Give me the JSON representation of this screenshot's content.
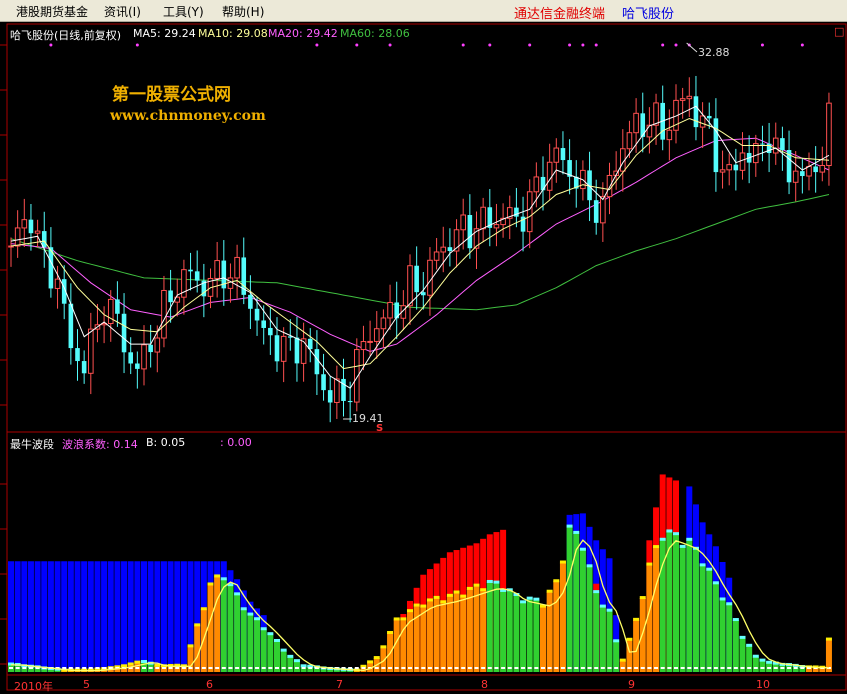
{
  "menu": {
    "items": [
      "港股期货基金",
      "资讯(I)",
      "工具(Y)",
      "帮助(H)"
    ],
    "brand_terminal": "通达信金融终端",
    "stock_name": "哈飞股份",
    "close_glyph": "□"
  },
  "legend": {
    "title": "哈飞股份(日线,前复权)",
    "ma5": "MA5: 29.24",
    "ma10": "MA10: 29.08",
    "ma20": "MA20: 29.42",
    "ma60": "MA60: 28.06"
  },
  "watermark": {
    "line1": "第一股票公式网",
    "line2": "www.chnmoney.com"
  },
  "annotations": {
    "high_label": "32.88",
    "low_label": "19.41",
    "signal_mark": "S"
  },
  "indicator": {
    "name": "最牛波段",
    "coef_label": "波浪系数: 0.14",
    "b_label": "B: 0.05",
    "extra_label": ": 0.00"
  },
  "xaxis": {
    "labels": [
      "2010年",
      "5",
      "6",
      "7",
      "8",
      "9",
      "10"
    ]
  },
  "colors": {
    "up": "#ff5050",
    "down": "#54fcfc",
    "ma5": "#ffffff",
    "ma10": "#ffff9a",
    "ma20": "#ff60ff",
    "ma60": "#40c040",
    "grid": "#aa0000",
    "hist_red": "#ff0000",
    "hist_blue": "#0000ff",
    "hist_orange": "#ff8a00",
    "hist_green": "#30d030",
    "menu_red": "#e00000",
    "menu_blue": "#0000e0"
  },
  "chart_data": {
    "type": "candlestick+histogram",
    "ylim": [
      19.0,
      34.5
    ],
    "high": 32.88,
    "low": 19.41,
    "price_path": [
      [
        0,
        26.3
      ],
      [
        3,
        27.6
      ],
      [
        5,
        25.6
      ],
      [
        7,
        25.0
      ],
      [
        9,
        22.1
      ],
      [
        11,
        21.5
      ],
      [
        13,
        23.0
      ],
      [
        14,
        24.0
      ],
      [
        16,
        23.2
      ],
      [
        18,
        21.6
      ],
      [
        19,
        21.2
      ],
      [
        21,
        22.4
      ],
      [
        23,
        23.6
      ],
      [
        25,
        24.8
      ],
      [
        27,
        25.1
      ],
      [
        29,
        24.7
      ],
      [
        31,
        25.0
      ],
      [
        32,
        25.3
      ],
      [
        34,
        25.1
      ],
      [
        36,
        24.0
      ],
      [
        38,
        22.6
      ],
      [
        40,
        22.4
      ],
      [
        42,
        22.0
      ],
      [
        44,
        22.5
      ],
      [
        46,
        21.0
      ],
      [
        48,
        20.3
      ],
      [
        50,
        20.0
      ],
      [
        52,
        21.5
      ],
      [
        54,
        22.8
      ],
      [
        57,
        23.5
      ],
      [
        60,
        24.6
      ],
      [
        62,
        24.8
      ],
      [
        64,
        25.9
      ],
      [
        66,
        26.6
      ],
      [
        68,
        26.9
      ],
      [
        71,
        27.2
      ],
      [
        74,
        27.5
      ],
      [
        76,
        27.4
      ],
      [
        78,
        28.0
      ],
      [
        80,
        29.3
      ],
      [
        82,
        30.0
      ],
      [
        84,
        29.4
      ],
      [
        86,
        28.6
      ],
      [
        88,
        28.0
      ],
      [
        89,
        27.7
      ],
      [
        90,
        29.0
      ],
      [
        92,
        30.4
      ],
      [
        94,
        31.2
      ],
      [
        96,
        31.5
      ],
      [
        98,
        31.0
      ],
      [
        100,
        31.9
      ],
      [
        102,
        32.4
      ],
      [
        103,
        31.7
      ],
      [
        105,
        30.9
      ],
      [
        107,
        29.4
      ],
      [
        108,
        29.0
      ],
      [
        110,
        30.3
      ],
      [
        111,
        29.8
      ],
      [
        112,
        30.0
      ],
      [
        114,
        30.9
      ],
      [
        115,
        30.1
      ],
      [
        117,
        29.6
      ],
      [
        119,
        28.9
      ],
      [
        120,
        29.4
      ],
      [
        122,
        29.9
      ],
      [
        123,
        31.3
      ]
    ],
    "ma_paths": {
      "ma5": [
        [
          0,
          26.5
        ],
        [
          4,
          26.7
        ],
        [
          8,
          24.6
        ],
        [
          11,
          22.6
        ],
        [
          14,
          23.2
        ],
        [
          18,
          22.3
        ],
        [
          21,
          22.3
        ],
        [
          25,
          24.3
        ],
        [
          29,
          24.8
        ],
        [
          32,
          25.0
        ],
        [
          36,
          24.4
        ],
        [
          40,
          22.9
        ],
        [
          44,
          22.4
        ],
        [
          48,
          21.0
        ],
        [
          51,
          20.5
        ],
        [
          54,
          21.8
        ],
        [
          58,
          23.4
        ],
        [
          62,
          24.5
        ],
        [
          66,
          26.0
        ],
        [
          70,
          26.9
        ],
        [
          74,
          27.4
        ],
        [
          78,
          27.8
        ],
        [
          82,
          29.4
        ],
        [
          86,
          29.0
        ],
        [
          89,
          28.2
        ],
        [
          92,
          29.7
        ],
        [
          96,
          31.2
        ],
        [
          100,
          31.6
        ],
        [
          103,
          32.0
        ],
        [
          106,
          31.0
        ],
        [
          109,
          29.7
        ],
        [
          112,
          30.0
        ],
        [
          115,
          30.3
        ],
        [
          119,
          29.4
        ],
        [
          123,
          30.0
        ]
      ],
      "ma10": [
        [
          0,
          26.3
        ],
        [
          5,
          26.5
        ],
        [
          10,
          24.6
        ],
        [
          14,
          23.5
        ],
        [
          18,
          22.9
        ],
        [
          22,
          22.8
        ],
        [
          26,
          23.8
        ],
        [
          30,
          24.6
        ],
        [
          34,
          24.9
        ],
        [
          38,
          24.0
        ],
        [
          42,
          23.2
        ],
        [
          46,
          22.4
        ],
        [
          50,
          21.3
        ],
        [
          54,
          21.5
        ],
        [
          58,
          22.6
        ],
        [
          62,
          23.8
        ],
        [
          66,
          25.2
        ],
        [
          70,
          26.3
        ],
        [
          74,
          27.0
        ],
        [
          78,
          27.5
        ],
        [
          82,
          28.4
        ],
        [
          86,
          28.8
        ],
        [
          90,
          28.6
        ],
        [
          94,
          30.0
        ],
        [
          98,
          31.0
        ],
        [
          102,
          31.5
        ],
        [
          106,
          31.1
        ],
        [
          110,
          30.4
        ],
        [
          114,
          30.4
        ],
        [
          118,
          29.9
        ],
        [
          123,
          29.8
        ]
      ],
      "ma20": [
        [
          0,
          26.4
        ],
        [
          6,
          26.2
        ],
        [
          12,
          24.8
        ],
        [
          18,
          23.7
        ],
        [
          24,
          23.4
        ],
        [
          30,
          24.0
        ],
        [
          36,
          24.2
        ],
        [
          42,
          23.6
        ],
        [
          48,
          22.7
        ],
        [
          54,
          22.0
        ],
        [
          58,
          22.3
        ],
        [
          64,
          23.5
        ],
        [
          70,
          24.9
        ],
        [
          76,
          26.0
        ],
        [
          82,
          27.2
        ],
        [
          88,
          28.0
        ],
        [
          94,
          28.9
        ],
        [
          100,
          29.9
        ],
        [
          106,
          30.6
        ],
        [
          112,
          30.7
        ],
        [
          118,
          30.0
        ],
        [
          123,
          29.4
        ]
      ],
      "ma60": [
        [
          0,
          26.6
        ],
        [
          10,
          25.7
        ],
        [
          20,
          25.0
        ],
        [
          30,
          24.9
        ],
        [
          40,
          24.8
        ],
        [
          50,
          24.3
        ],
        [
          60,
          23.8
        ],
        [
          70,
          23.7
        ],
        [
          76,
          23.9
        ],
        [
          82,
          24.6
        ],
        [
          88,
          25.5
        ],
        [
          94,
          26.1
        ],
        [
          100,
          26.6
        ],
        [
          106,
          27.2
        ],
        [
          112,
          27.8
        ],
        [
          118,
          28.1
        ],
        [
          123,
          28.4
        ]
      ]
    },
    "hist_path": [
      [
        0,
        0.5
      ],
      [
        4,
        0.3
      ],
      [
        8,
        0.1
      ],
      [
        12,
        0.1
      ],
      [
        16,
        0.3
      ],
      [
        20,
        0.7
      ],
      [
        22,
        0.4
      ],
      [
        26,
        0.4
      ],
      [
        28,
        3.0
      ],
      [
        30,
        5.8
      ],
      [
        32,
        6.5
      ],
      [
        34,
        5.0
      ],
      [
        36,
        3.8
      ],
      [
        38,
        3.0
      ],
      [
        40,
        2.0
      ],
      [
        42,
        1.0
      ],
      [
        44,
        0.4
      ],
      [
        48,
        0.2
      ],
      [
        52,
        0.1
      ],
      [
        55,
        0.9
      ],
      [
        58,
        3.4
      ],
      [
        62,
        4.6
      ],
      [
        66,
        5.0
      ],
      [
        70,
        5.6
      ],
      [
        72,
        5.9
      ],
      [
        74,
        5.7
      ],
      [
        76,
        5.0
      ],
      [
        78,
        4.8
      ],
      [
        80,
        4.6
      ],
      [
        82,
        5.9
      ],
      [
        84,
        9.5
      ],
      [
        86,
        8.6
      ],
      [
        88,
        5.2
      ],
      [
        90,
        4.0
      ],
      [
        91,
        2.0
      ],
      [
        92,
        0.8
      ],
      [
        94,
        3.4
      ],
      [
        96,
        7.0
      ],
      [
        98,
        9.3
      ],
      [
        100,
        9.0
      ],
      [
        102,
        8.6
      ],
      [
        104,
        7.5
      ],
      [
        106,
        5.8
      ],
      [
        108,
        4.4
      ],
      [
        110,
        2.4
      ],
      [
        112,
        1.0
      ],
      [
        114,
        0.6
      ],
      [
        116,
        0.5
      ],
      [
        118,
        0.4
      ],
      [
        120,
        0.3
      ],
      [
        122,
        0.3
      ],
      [
        123,
        2.1
      ]
    ],
    "hist_red_path": [
      [
        28,
        0
      ],
      [
        30,
        1.0
      ],
      [
        32,
        1.8
      ],
      [
        34,
        0
      ],
      [
        56,
        0
      ],
      [
        58,
        3.0
      ],
      [
        62,
        6.5
      ],
      [
        66,
        8.0
      ],
      [
        70,
        8.6
      ],
      [
        72,
        9.2
      ],
      [
        74,
        9.5
      ],
      [
        76,
        0
      ],
      [
        86,
        0
      ],
      [
        88,
        5.9
      ],
      [
        90,
        3.0
      ],
      [
        91,
        0
      ],
      [
        94,
        0
      ],
      [
        96,
        8.8
      ],
      [
        98,
        13.2
      ],
      [
        100,
        12.8
      ],
      [
        102,
        0
      ],
      [
        104,
        0
      ]
    ],
    "hist_blue_path": [
      [
        32,
        7.4
      ],
      [
        34,
        6.2
      ],
      [
        36,
        4.7
      ],
      [
        38,
        3.8
      ],
      [
        40,
        0
      ],
      [
        82,
        0
      ],
      [
        84,
        10.5
      ],
      [
        86,
        10.6
      ],
      [
        88,
        8.8
      ],
      [
        90,
        7.6
      ],
      [
        92,
        0
      ],
      [
        100,
        0
      ],
      [
        102,
        12.4
      ],
      [
        104,
        10.0
      ],
      [
        106,
        8.4
      ],
      [
        108,
        6.3
      ],
      [
        110,
        0
      ]
    ],
    "hist_ylim": [
      0,
      14.5
    ]
  }
}
